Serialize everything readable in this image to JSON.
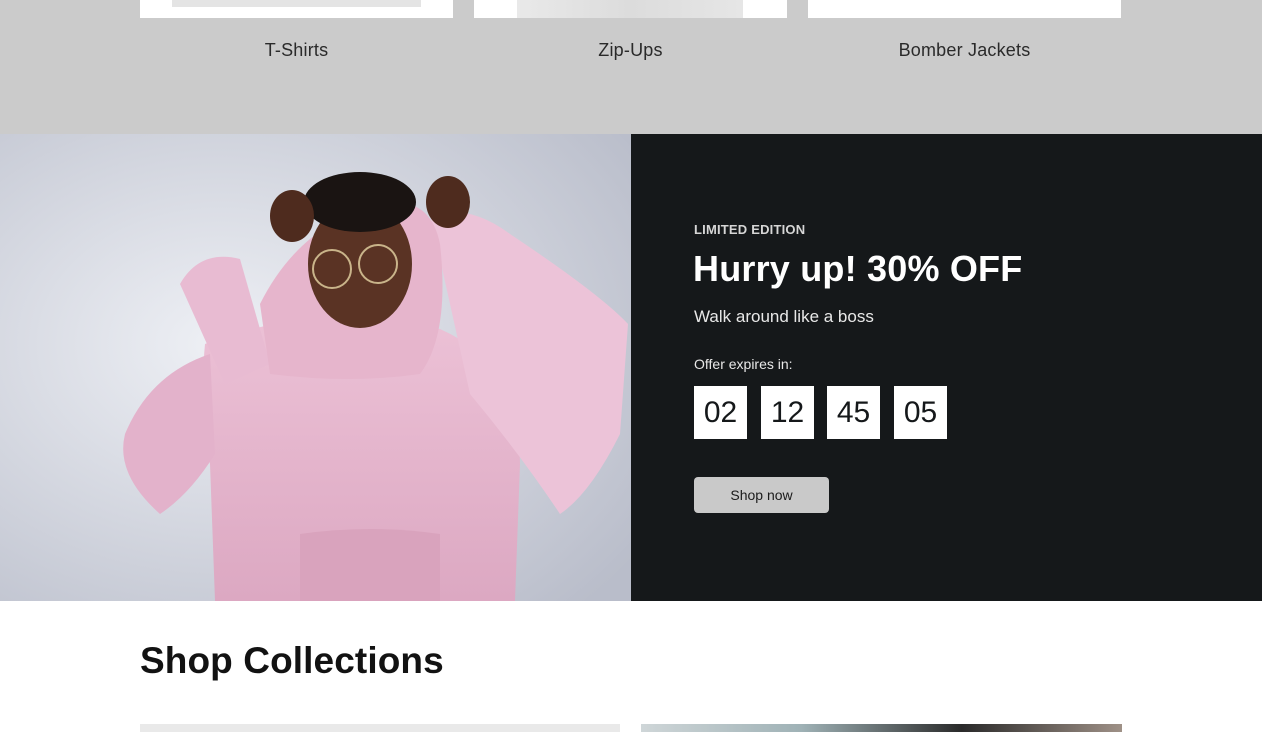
{
  "categories": [
    {
      "label": "T-Shirts"
    },
    {
      "label": "Zip-Ups"
    },
    {
      "label": "Bomber Jackets"
    }
  ],
  "promo": {
    "eyebrow": "LIMITED EDITION",
    "headline": "Hurry up! 30% OFF",
    "tagline": "Walk around like a boss",
    "expires_label": "Offer expires in:",
    "countdown": [
      "02",
      "12",
      "45",
      "05"
    ],
    "cta_label": "Shop now"
  },
  "collections": {
    "title": "Shop Collections"
  },
  "colors": {
    "strip_bg": "#cbcbcb",
    "promo_dark": "#15181a",
    "button_bg": "#c9c9c9",
    "hoodie": "#e7b8cf"
  }
}
